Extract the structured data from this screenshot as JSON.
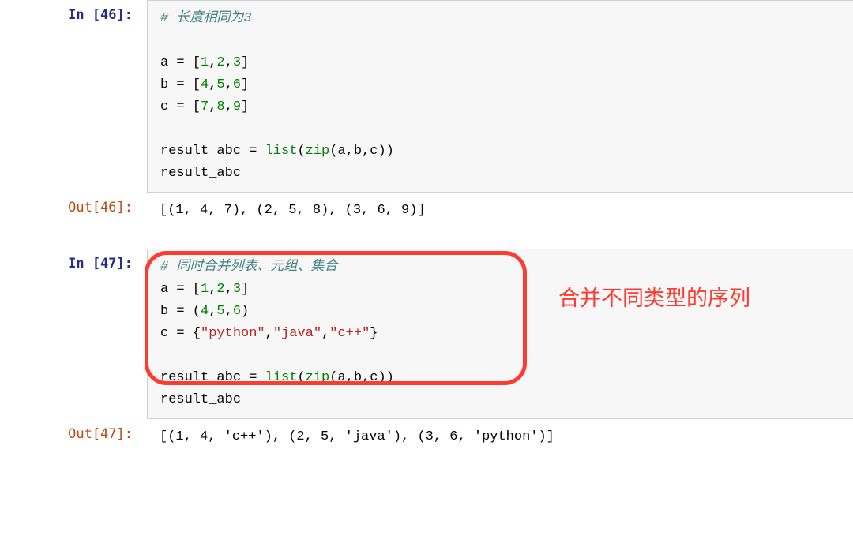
{
  "cell46": {
    "in_prompt": "In [46]:",
    "out_prompt": "Out[46]:",
    "comment": "# 长度相同为3",
    "a_name": "a",
    "a_assign": " = [",
    "a_v1": "1",
    "a_c1": ",",
    "a_v2": "2",
    "a_c2": ",",
    "a_v3": "3",
    "a_close": "]",
    "b_name": "b",
    "b_assign": " = [",
    "b_v1": "4",
    "b_c1": ",",
    "b_v2": "5",
    "b_c2": ",",
    "b_v3": "6",
    "b_close": "]",
    "c_name": "c",
    "c_assign": " = [",
    "c_v1": "7",
    "c_c1": ",",
    "c_v2": "8",
    "c_c2": ",",
    "c_v3": "9",
    "c_close": "]",
    "res_name": "result_abc",
    "res_eq": " = ",
    "res_list": "list",
    "res_lp": "(",
    "res_zip": "zip",
    "res_args": "(a,b,c))",
    "res_echo": "result_abc",
    "output": "[(1, 4, 7), (2, 5, 8), (3, 6, 9)]"
  },
  "cell47": {
    "in_prompt": "In [47]:",
    "out_prompt": "Out[47]:",
    "comment": "# 同时合并列表、元组、集合",
    "a_name": "a",
    "a_assign": " = [",
    "a_v1": "1",
    "a_c1": ",",
    "a_v2": "2",
    "a_c2": ",",
    "a_v3": "3",
    "a_close": "]",
    "b_name": "b",
    "b_assign": " = (",
    "b_v1": "4",
    "b_c1": ",",
    "b_v2": "5",
    "b_c2": ",",
    "b_v3": "6",
    "b_close": ")",
    "c_name": "c",
    "c_assign": " = {",
    "c_v1": "\"python\"",
    "c_c1": ",",
    "c_v2": "\"java\"",
    "c_c2": ",",
    "c_v3": "\"c++\"",
    "c_close": "}",
    "res_name": "result_abc",
    "res_eq": " = ",
    "res_list": "list",
    "res_lp": "(",
    "res_zip": "zip",
    "res_args": "(a,b,c))",
    "res_echo": "result_abc",
    "output": "[(1, 4, 'c++'), (2, 5, 'java'), (3, 6, 'python')]",
    "annotation": "合并不同类型的序列"
  }
}
